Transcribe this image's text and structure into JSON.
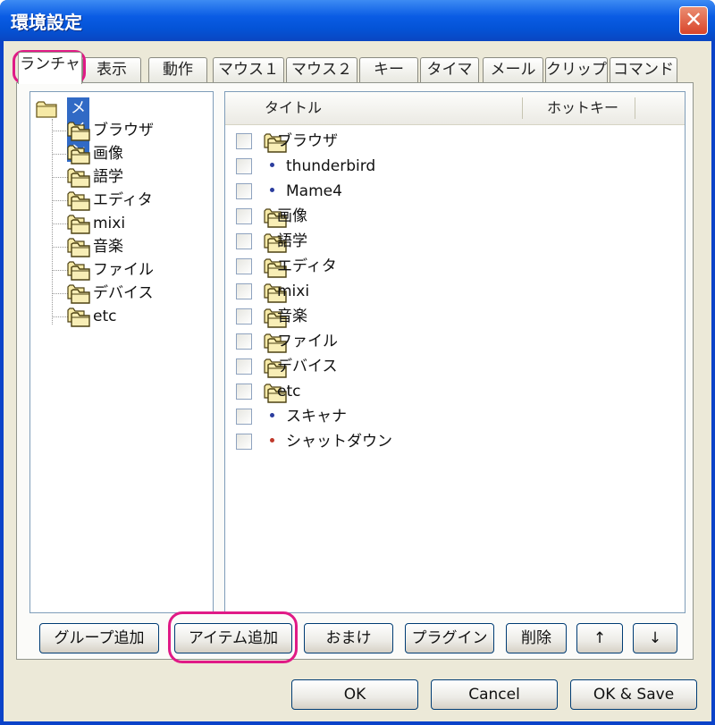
{
  "window": {
    "title": "環境設定",
    "close_label": "✕"
  },
  "tabs": [
    {
      "label": "ランチャ"
    },
    {
      "label": "表示"
    },
    {
      "label": "動作"
    },
    {
      "label": "マウス１"
    },
    {
      "label": "マウス２"
    },
    {
      "label": "キー"
    },
    {
      "label": "タイマ"
    },
    {
      "label": "メール"
    },
    {
      "label": "クリップ"
    },
    {
      "label": "コマンド"
    }
  ],
  "tree": {
    "root": "メイン",
    "items": [
      {
        "label": "ブラウザ"
      },
      {
        "label": "画像"
      },
      {
        "label": "語学"
      },
      {
        "label": "エディタ"
      },
      {
        "label": "mixi"
      },
      {
        "label": "音楽"
      },
      {
        "label": "ファイル"
      },
      {
        "label": "デバイス"
      },
      {
        "label": "etc"
      }
    ]
  },
  "list": {
    "columns": {
      "title": "タイトル",
      "hotkey": "ホットキー"
    },
    "rows": [
      {
        "label": "ブラウザ",
        "kind": "folder"
      },
      {
        "label": "thunderbird",
        "kind": "item"
      },
      {
        "label": "Mame4",
        "kind": "item"
      },
      {
        "label": "画像",
        "kind": "folder"
      },
      {
        "label": "語学",
        "kind": "folder"
      },
      {
        "label": "エディタ",
        "kind": "folder"
      },
      {
        "label": "mixi",
        "kind": "folder"
      },
      {
        "label": "音楽",
        "kind": "folder"
      },
      {
        "label": "ファイル",
        "kind": "folder"
      },
      {
        "label": "デバイス",
        "kind": "folder"
      },
      {
        "label": "etc",
        "kind": "folder"
      },
      {
        "label": "スキャナ",
        "kind": "item"
      },
      {
        "label": "シャットダウン",
        "kind": "item-red"
      }
    ]
  },
  "buttons": {
    "add_group": "グループ追加",
    "add_item": "アイテム追加",
    "extras": "おまけ",
    "plugin": "プラグイン",
    "delete": "削除",
    "up": "↑",
    "down": "↓",
    "ok": "OK",
    "cancel": "Cancel",
    "ok_save": "OK & Save"
  },
  "colors": {
    "highlight": "#e01a86",
    "titlebar": "#0453d6",
    "selection": "#316ac5"
  }
}
